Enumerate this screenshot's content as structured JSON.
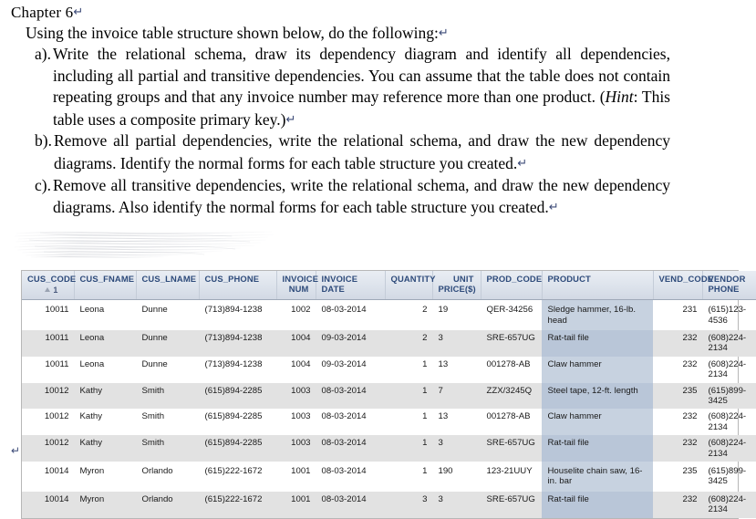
{
  "document": {
    "chapter": "Chapter 6",
    "pilcrow": "↵",
    "intro": "Using the invoice table structure shown below, do the following:",
    "items": [
      {
        "marker": "a).",
        "lines": [
          "Write the relational schema, draw its dependency diagram and identify all",
          "dependencies, including all partial and transitive dependencies. You can assume that",
          "the table does not contain repeating groups and that any invoice number may reference",
          "more than one product. (Hint: This table uses a composite primary key.)"
        ],
        "text": "Write the relational schema, draw its dependency diagram and identify all dependencies, including all partial and transitive dependencies. You can assume that the table does not contain repeating groups and that any invoice number may reference more than one product. (Hint: This table uses a composite primary key.)"
      },
      {
        "marker": "b).",
        "lines": [
          "Remove all partial dependencies, write the relational schema, and draw the new",
          "dependency diagrams. Identify the normal forms for each table structure you created."
        ],
        "text": "Remove all partial dependencies, write the relational schema, and draw the new dependency diagrams. Identify the normal forms for each table structure you created."
      },
      {
        "marker": "c).",
        "lines": [
          "Remove all transitive dependencies, write the relational schema, and draw the new",
          "dependency diagrams. Also identify the normal forms for each table structure you",
          "created."
        ],
        "text": "Remove all transitive dependencies, write the relational schema, and draw the new dependency diagrams. Also identify the normal forms for each table structure you created."
      }
    ],
    "end_mark": "↵"
  },
  "table": {
    "sort_indicator": "1",
    "sorted_column": "CUS_CODE",
    "columns": [
      {
        "key": "cus_code",
        "label": "CUS_CODE",
        "align": "right"
      },
      {
        "key": "cus_fname",
        "label": "CUS_FNAME",
        "align": "left"
      },
      {
        "key": "cus_lname",
        "label": "CUS_LNAME",
        "align": "left"
      },
      {
        "key": "cus_phone",
        "label": "CUS_PHONE",
        "align": "left"
      },
      {
        "key": "invoice_num",
        "label": "INVOICE NUM",
        "align": "right"
      },
      {
        "key": "invoice_date",
        "label": "INVOICE DATE",
        "align": "left"
      },
      {
        "key": "quantity",
        "label": "QUANTITY",
        "align": "right"
      },
      {
        "key": "unit_price",
        "label": "UNIT PRICE($)",
        "align": "left"
      },
      {
        "key": "prod_code",
        "label": "PROD_CODE",
        "align": "left"
      },
      {
        "key": "product",
        "label": "PRODUCT",
        "align": "left"
      },
      {
        "key": "vend_code",
        "label": "VEND_CODE",
        "align": "right"
      },
      {
        "key": "vendor_phone",
        "label": "VENDOR PHONE",
        "align": "left"
      }
    ],
    "header_labels": {
      "cus_code": "CUS_CODE",
      "cus_fname": "CUS_FNAME",
      "cus_lname": "CUS_LNAME",
      "cus_phone": "CUS_PHONE",
      "invoice_num_l1": "INVOICE",
      "invoice_num_l2": "NUM",
      "invoice_date_l1": "INVOICE",
      "invoice_date_l2": "DATE",
      "quantity": "QUANTITY",
      "unit_price_l1": "UNIT",
      "unit_price_l2": "PRICE($)",
      "prod_code": "PROD_CODE",
      "product": "PRODUCT",
      "vend_code": "VEND_CODE",
      "vendor_phone_l1": "VENDOR",
      "vendor_phone_l2": "PHONE"
    },
    "rows": [
      {
        "cus_code": "10011",
        "cus_fname": "Leona",
        "cus_lname": "Dunne",
        "cus_phone": "(713)894-1238",
        "invoice_num": "1002",
        "invoice_date": "08-03-2014",
        "quantity": "2",
        "unit_price": "19",
        "prod_code": "QER-34256",
        "product": "Sledge hammer, 16-lb. head",
        "vend_code": "231",
        "vendor_phone": "(615)123-4536",
        "tall": true,
        "alt": false
      },
      {
        "cus_code": "10011",
        "cus_fname": "Leona",
        "cus_lname": "Dunne",
        "cus_phone": "(713)894-1238",
        "invoice_num": "1004",
        "invoice_date": "09-03-2014",
        "quantity": "2",
        "unit_price": "3",
        "prod_code": "SRE-657UG",
        "product": "Rat-tail file",
        "vend_code": "232",
        "vendor_phone": "(608)224-2134",
        "tall": false,
        "alt": true
      },
      {
        "cus_code": "10011",
        "cus_fname": "Leona",
        "cus_lname": "Dunne",
        "cus_phone": "(713)894-1238",
        "invoice_num": "1004",
        "invoice_date": "09-03-2014",
        "quantity": "1",
        "unit_price": "13",
        "prod_code": "001278-AB",
        "product": "Claw hammer",
        "vend_code": "232",
        "vendor_phone": "(608)224-2134",
        "tall": false,
        "alt": false
      },
      {
        "cus_code": "10012",
        "cus_fname": "Kathy",
        "cus_lname": "Smith",
        "cus_phone": "(615)894-2285",
        "invoice_num": "1003",
        "invoice_date": "08-03-2014",
        "quantity": "1",
        "unit_price": "7",
        "prod_code": "ZZX/3245Q",
        "product": "Steel tape, 12-ft. length",
        "vend_code": "235",
        "vendor_phone": "(615)899-3425",
        "tall": false,
        "alt": true
      },
      {
        "cus_code": "10012",
        "cus_fname": "Kathy",
        "cus_lname": "Smith",
        "cus_phone": "(615)894-2285",
        "invoice_num": "1003",
        "invoice_date": "08-03-2014",
        "quantity": "1",
        "unit_price": "13",
        "prod_code": "001278-AB",
        "product": "Claw hammer",
        "vend_code": "232",
        "vendor_phone": "(608)224-2134",
        "tall": false,
        "alt": false
      },
      {
        "cus_code": "10012",
        "cus_fname": "Kathy",
        "cus_lname": "Smith",
        "cus_phone": "(615)894-2285",
        "invoice_num": "1003",
        "invoice_date": "08-03-2014",
        "quantity": "1",
        "unit_price": "3",
        "prod_code": "SRE-657UG",
        "product": "Rat-tail file",
        "vend_code": "232",
        "vendor_phone": "(608)224-2134",
        "tall": false,
        "alt": true
      },
      {
        "cus_code": "10014",
        "cus_fname": "Myron",
        "cus_lname": "Orlando",
        "cus_phone": "(615)222-1672",
        "invoice_num": "1001",
        "invoice_date": "08-03-2014",
        "quantity": "1",
        "unit_price": "190",
        "prod_code": "123-21UUY",
        "product": "Houselite chain saw, 16-in. bar",
        "vend_code": "235",
        "vendor_phone": "(615)899-3425",
        "tall": true,
        "alt": false
      },
      {
        "cus_code": "10014",
        "cus_fname": "Myron",
        "cus_lname": "Orlando",
        "cus_phone": "(615)222-1672",
        "invoice_num": "1001",
        "invoice_date": "08-03-2014",
        "quantity": "3",
        "unit_price": "3",
        "prod_code": "SRE-657UG",
        "product": "Rat-tail file",
        "vend_code": "232",
        "vendor_phone": "(608)224-2134",
        "tall": false,
        "alt": true
      }
    ]
  },
  "colors": {
    "header_text": "#2d4a7a",
    "header_bg": "#dde3ec",
    "row_alt_bg": "#e2e2e2",
    "product_col_bg": "#c7d2e0",
    "product_col_alt_bg": "#b9c6d8",
    "border": "#b7b7b7",
    "pilcrow": "#3b4a77"
  }
}
